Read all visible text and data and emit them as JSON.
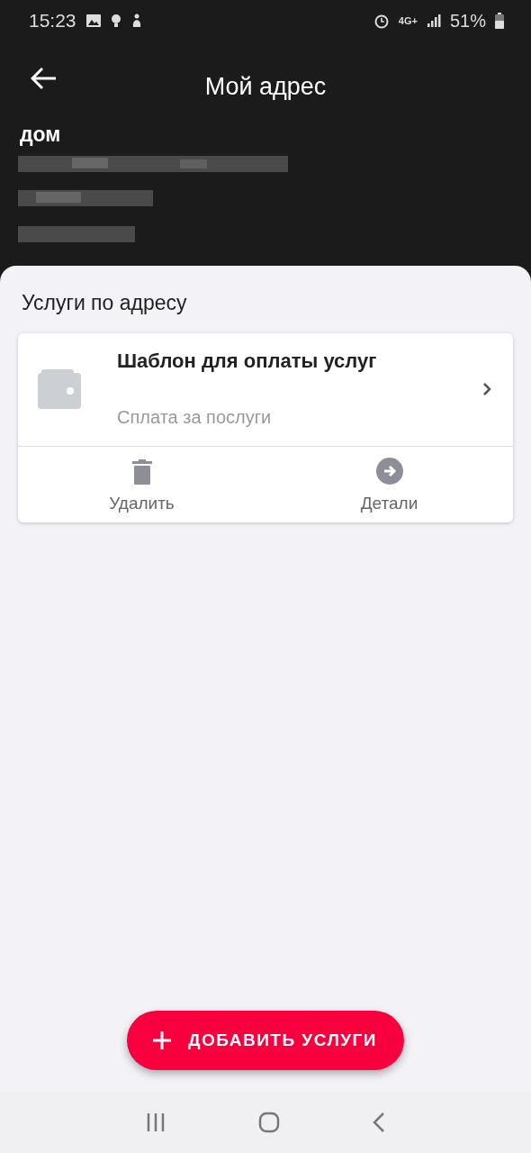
{
  "status_bar": {
    "time": "15:23",
    "network": "4G+",
    "battery": "51%"
  },
  "header": {
    "title": "Мой адрес",
    "address_label": "дом"
  },
  "section": {
    "title": "Услуги по адресу"
  },
  "services": [
    {
      "title": "Шаблон для оплаты услуг",
      "subtitle": "Сплата за послуги",
      "actions": [
        {
          "kind": "delete",
          "label": "Удалить"
        },
        {
          "kind": "details",
          "label": "Детали"
        }
      ]
    }
  ],
  "fab": {
    "label": "ДОБАВИТЬ УСЛУГИ"
  }
}
